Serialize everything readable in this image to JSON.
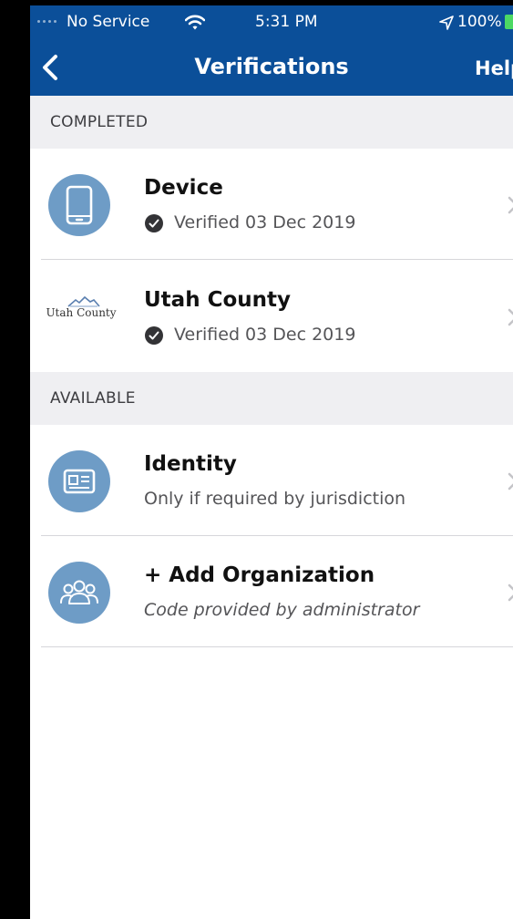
{
  "status_bar": {
    "carrier": "No Service",
    "time": "5:31 PM",
    "battery": "100%"
  },
  "nav": {
    "title": "Verifications",
    "help_label": "Help"
  },
  "sections": {
    "completed": {
      "header": "COMPLETED",
      "items": [
        {
          "title": "Device",
          "status": "Verified 03 Dec 2019",
          "icon": "phone-icon"
        },
        {
          "title": "Utah County",
          "status": "Verified 03 Dec 2019",
          "logo_text": "Utah County",
          "icon": "utah-county-logo"
        }
      ]
    },
    "available": {
      "header": "AVAILABLE",
      "items": [
        {
          "title": "Identity",
          "subtitle": "Only if required by jurisdiction",
          "icon": "id-card-icon"
        },
        {
          "title": "+ Add Organization",
          "subtitle": "Code provided by administrator",
          "icon": "group-icon"
        }
      ]
    }
  },
  "colors": {
    "header_bg": "#0b4f99",
    "icon_circle": "#6e9cc6",
    "section_bg": "#efeff2",
    "battery": "#4cd964"
  }
}
